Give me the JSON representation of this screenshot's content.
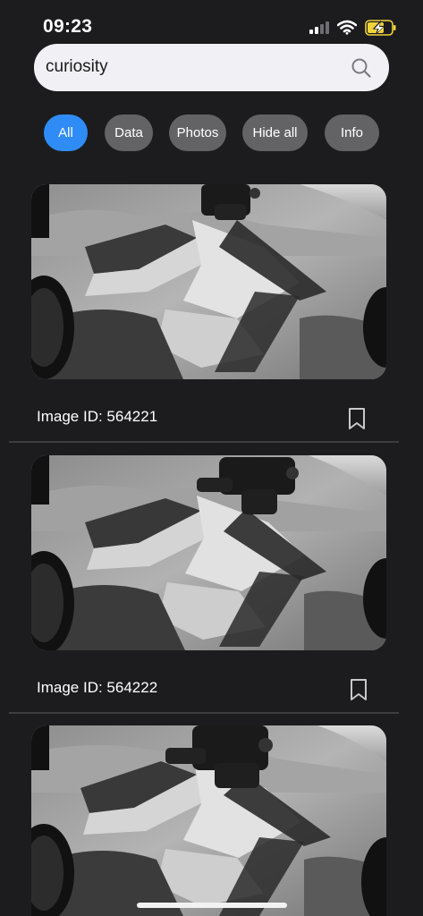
{
  "status_bar": {
    "time": "09:23"
  },
  "search": {
    "value": "curiosity"
  },
  "filters": [
    "All",
    "Data",
    "Photos",
    "Hide all",
    "Info"
  ],
  "results": [
    {
      "caption": "Image ID: 564221"
    },
    {
      "caption": "Image ID: 564222"
    },
    {
      "caption": ""
    }
  ],
  "colors": {
    "accent": "#2f8cf7",
    "chip": "#636366",
    "background": "#1c1c1e",
    "search_field": "#f1f0f5"
  },
  "icons": [
    "signal-icon",
    "wifi-icon",
    "battery-charging-icon",
    "search-icon",
    "bookmark-icon"
  ]
}
